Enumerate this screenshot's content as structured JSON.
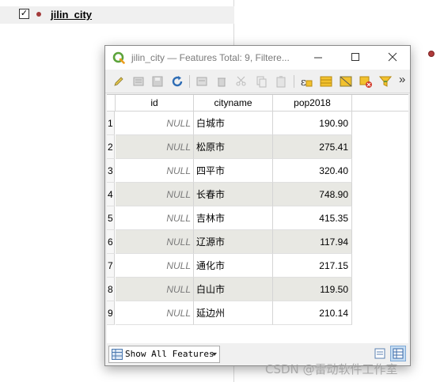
{
  "layer_panel": {
    "layer_name": "jilin_city",
    "checked_mark": "✓"
  },
  "window": {
    "title": "jilin_city — Features Total: 9, Filtere...",
    "icons": [
      "qgis-logo-icon",
      "minimize-icon",
      "maximize-icon",
      "close-icon"
    ]
  },
  "toolbar": {
    "icons": [
      "pencil-edit-icon",
      "multi-edit-icon",
      "save-edits-icon",
      "reload-icon",
      "add-feature-icon",
      "delete-feature-icon",
      "cut-icon",
      "copy-icon",
      "paste-icon",
      "expression-select-icon",
      "select-all-icon",
      "invert-selection-icon",
      "deselect-icon",
      "filter-icon"
    ],
    "overflow": "»"
  },
  "table": {
    "columns": [
      "id",
      "cityname",
      "pop2018"
    ],
    "rows": [
      {
        "n": "1",
        "id": "NULL",
        "cityname": "白城市",
        "pop2018": "190.90"
      },
      {
        "n": "2",
        "id": "NULL",
        "cityname": "松原市",
        "pop2018": "275.41"
      },
      {
        "n": "3",
        "id": "NULL",
        "cityname": "四平市",
        "pop2018": "320.40"
      },
      {
        "n": "4",
        "id": "NULL",
        "cityname": "长春市",
        "pop2018": "748.90"
      },
      {
        "n": "5",
        "id": "NULL",
        "cityname": "吉林市",
        "pop2018": "415.35"
      },
      {
        "n": "6",
        "id": "NULL",
        "cityname": "辽源市",
        "pop2018": "117.94"
      },
      {
        "n": "7",
        "id": "NULL",
        "cityname": "通化市",
        "pop2018": "217.15"
      },
      {
        "n": "8",
        "id": "NULL",
        "cityname": "白山市",
        "pop2018": "119.50"
      },
      {
        "n": "9",
        "id": "NULL",
        "cityname": "延边州",
        "pop2018": "210.14"
      }
    ]
  },
  "bottom": {
    "show_features": "Show All Features"
  },
  "watermark": "CSDN @雷动软件工作室",
  "colors": {
    "alt_row": "#e8e8e3",
    "point": "#b03a3a",
    "active_view": "#c5dcf2"
  }
}
